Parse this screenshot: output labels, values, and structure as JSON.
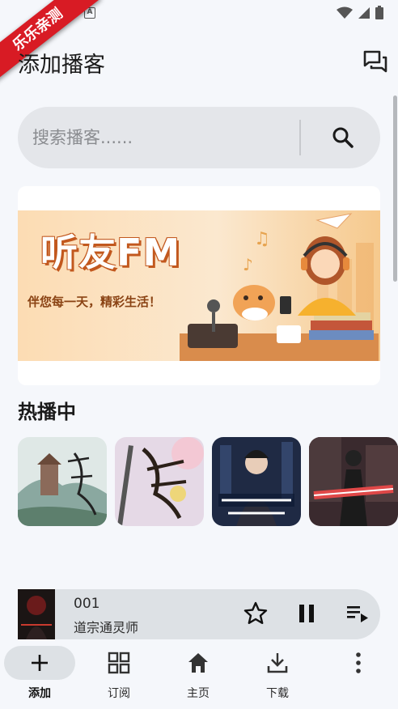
{
  "ribbon": {
    "text": "乐乐亲测"
  },
  "header": {
    "title": "添加播客",
    "action_icon": "chat-bubbles-icon"
  },
  "search": {
    "placeholder": "搜索播客......",
    "icon": "search-icon"
  },
  "banner": {
    "title": "听友FM",
    "tagline": "伴您每一天，精彩生活！"
  },
  "hot": {
    "title": "热播中",
    "covers": [
      "cover-fanren",
      "cover-jianlai",
      "cover-jiangfang",
      "cover-dijiu-tequ"
    ]
  },
  "player": {
    "episode": "001",
    "show": "道宗通灵师",
    "cover_text": "道宗通灵师"
  },
  "nav": {
    "items": [
      {
        "label": "添加",
        "icon": "plus-icon",
        "active": true
      },
      {
        "label": "订阅",
        "icon": "grid-icon",
        "active": false
      },
      {
        "label": "主页",
        "icon": "home-icon",
        "active": false
      },
      {
        "label": "下载",
        "icon": "download-icon",
        "active": false
      }
    ]
  },
  "colors": {
    "background": "#f5f7fb",
    "search_bg": "#e4e6ea",
    "pill": "#dde1e5",
    "ribbon": "#d81b24",
    "banner_orange": "#f29b4a"
  }
}
